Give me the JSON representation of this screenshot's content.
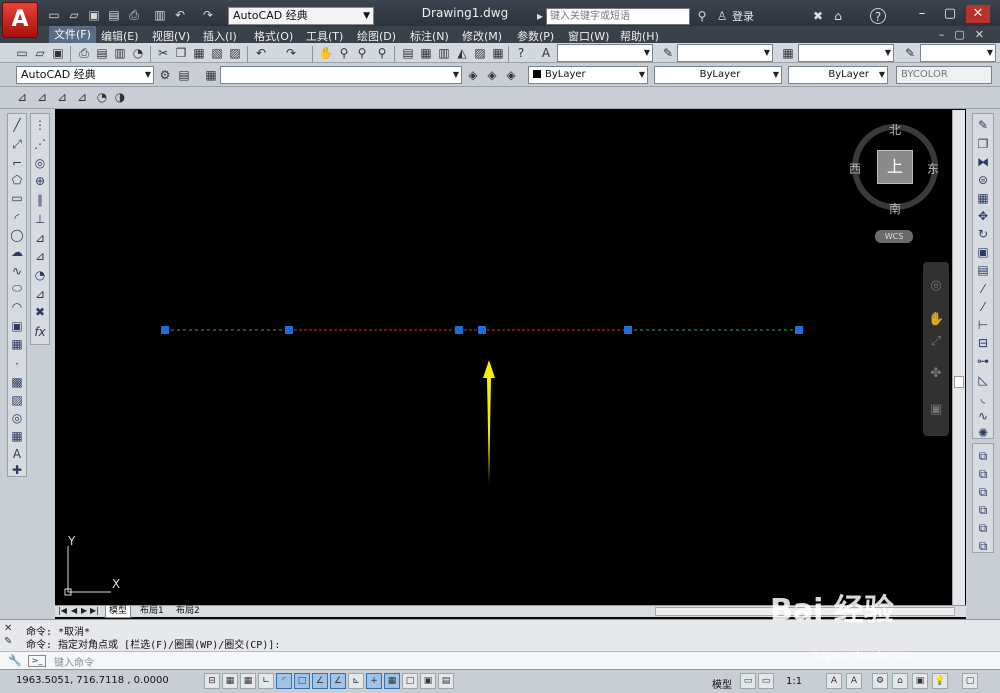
{
  "titlebar": {
    "app_logo_letter": "A",
    "workspace": "AutoCAD 经典",
    "document_title": "Drawing1.dwg",
    "search_placeholder": "键入关键字或短语",
    "login_label": "登录",
    "help_label": "?"
  },
  "menu": {
    "items": [
      "文件(F)",
      "编辑(E)",
      "视图(V)",
      "插入(I)",
      "格式(O)",
      "工具(T)",
      "绘图(D)",
      "标注(N)",
      "修改(M)",
      "参数(P)",
      "窗口(W)",
      "帮助(H)"
    ],
    "active_index": 0
  },
  "toolbar2": {
    "workspace_combo": "AutoCAD 经典",
    "layer_combo": "",
    "color_combo": "ByLayer",
    "linetype_combo": "ByLayer",
    "lineweight_combo": "ByLayer",
    "plotstyle_combo": "BYCOLOR"
  },
  "viewcube": {
    "north": "北",
    "south": "南",
    "east": "东",
    "west": "西",
    "face": "上",
    "wcs": "WCS"
  },
  "ucs": {
    "x_label": "X",
    "y_label": "Y"
  },
  "layout_tabs": [
    "模型",
    "布局1",
    "布局2"
  ],
  "command": {
    "history": [
      "命令: *取消*",
      "命令: 指定对角点或 [栏选(F)/圈围(WP)/圈交(CP)]:"
    ],
    "input_placeholder": "键入命令"
  },
  "status": {
    "coordinates": "1963.5051,  716.7118 ,  0.0000",
    "model_label": "模型",
    "scale_label": "1:1"
  },
  "colors": {
    "grip": "#1e6fd9",
    "line_red": "#d03030",
    "line_green": "#3aa05a",
    "arrow": "#f0f000",
    "menu_active": "#5a6d86"
  },
  "watermark": {
    "brand": "Bai 经验",
    "url": "jingyan.baidu.com"
  }
}
